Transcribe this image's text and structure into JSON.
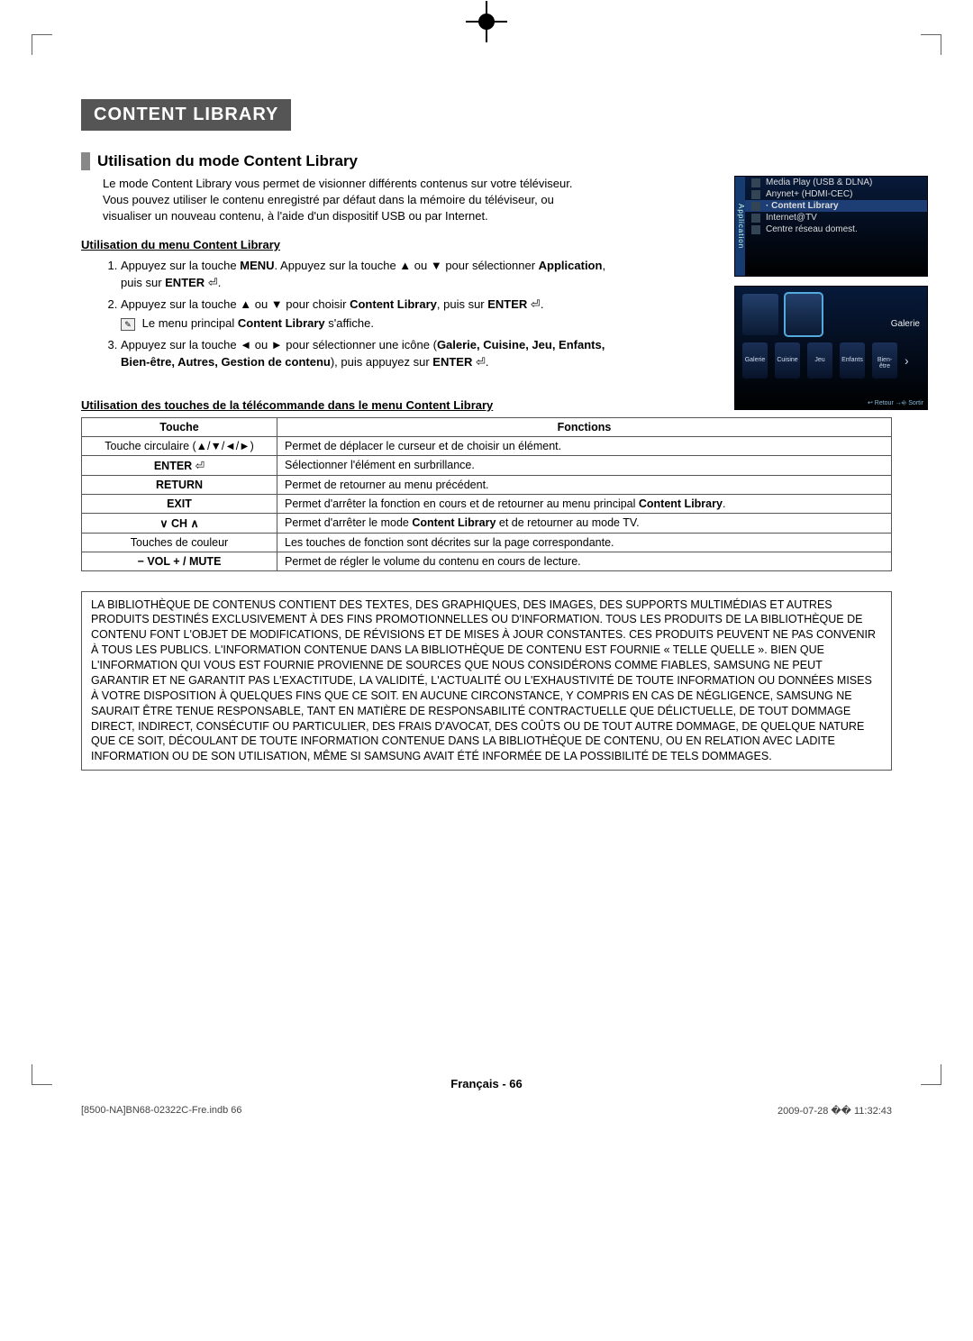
{
  "chapter": "CONTENT LIBRARY",
  "section_title": "Utilisation du mode Content Library",
  "intro": "Le mode Content Library vous permet de visionner différents contenus sur votre téléviseur. Vous pouvez utiliser le contenu enregistré par défaut dans la mémoire du téléviseur, ou visualiser un nouveau contenu, à l'aide d'un dispositif USB ou par Internet.",
  "sub1": "Utilisation du menu Content Library",
  "step1_a": "Appuyez sur la touche ",
  "step1_menu": "MENU",
  "step1_b": ". Appuyez sur la touche ▲ ou ▼ pour sélectionner ",
  "step1_app": "Application",
  "step1_c": ", puis sur ",
  "step1_enter": "ENTER",
  "step1_d": ".",
  "step2_a": "Appuyez sur la touche ▲ ou ▼ pour choisir ",
  "step2_cl": "Content Library",
  "step2_b": ", puis sur ",
  "step2_enter": "ENTER",
  "step2_c": ".",
  "step2_note_a": "Le menu principal ",
  "step2_note_cl": "Content Library",
  "step2_note_b": " s'affiche.",
  "step3_a": "Appuyez sur la touche ◄ ou ► pour sélectionner une icône (",
  "step3_list": "Galerie, Cuisine, Jeu, Enfants, Bien-être, Autres, Gestion de contenu",
  "step3_b": "), puis appuyez sur ",
  "step3_enter": "ENTER",
  "step3_c": ".",
  "sub2": "Utilisation des touches de la télécommande dans le menu Content Library",
  "table": {
    "th_key": "Touche",
    "th_fn": "Fonctions",
    "rows": [
      {
        "key": "Touche circulaire (▲/▼/◄/►)",
        "fn": "Permet de déplacer le curseur et de choisir un élément."
      },
      {
        "key_html": "<span class='b'>ENTER</span> ⏎",
        "fn": "Sélectionner l'élément en surbrillance."
      },
      {
        "key_html": "<span class='b'>RETURN</span>",
        "fn": "Permet de retourner au menu précédent."
      },
      {
        "key_html": "<span class='b'>EXIT</span>",
        "fn_html": "Permet d'arrêter la fonction en cours et de retourner au menu principal <span class='b'>Content Library</span>."
      },
      {
        "key_html": "<span class='b'>∨ CH ∧</span>",
        "fn_html": "Permet d'arrêter le mode <span class='b'>Content Library</span> et de retourner au mode TV."
      },
      {
        "key": "Touches de couleur",
        "fn": "Les touches de fonction sont décrites sur la page correspondante."
      },
      {
        "key_html": "<span class='b'>− VOL + / MUTE</span>",
        "fn": "Permet de régler le volume du contenu en cours de lecture."
      }
    ]
  },
  "disclaimer": "LA BIBLIOTHÈQUE DE CONTENUS CONTIENT DES TEXTES, DES GRAPHIQUES, DES IMAGES, DES SUPPORTS MULTIMÉDIAS ET AUTRES PRODUITS DESTINÉS EXCLUSIVEMENT À DES FINS PROMOTIONNELLES OU D'INFORMATION. TOUS LES PRODUITS DE LA BIBLIOTHÈQUE DE CONTENU FONT L'OBJET DE MODIFICATIONS, DE RÉVISIONS ET DE MISES À JOUR CONSTANTES. CES PRODUITS PEUVENT NE PAS CONVENIR À TOUS LES PUBLICS. L'INFORMATION CONTENUE DANS LA BIBLIOTHÈQUE DE CONTENU EST FOURNIE « TELLE QUELLE ». BIEN QUE L'INFORMATION QUI VOUS EST FOURNIE PROVIENNE DE SOURCES QUE NOUS CONSIDÉRONS COMME FIABLES, SAMSUNG NE PEUT GARANTIR ET NE GARANTIT PAS L'EXACTITUDE, LA VALIDITÉ, L'ACTUALITÉ OU L'EXHAUSTIVITÉ DE TOUTE INFORMATION OU DONNÉES MISES À VOTRE DISPOSITION À QUELQUES FINS QUE CE SOIT. EN AUCUNE CIRCONSTANCE, Y COMPRIS EN CAS DE NÉGLIGENCE, SAMSUNG NE SAURAIT ÊTRE TENUE RESPONSABLE, TANT EN MATIÈRE DE RESPONSABILITÉ CONTRACTUELLE QUE DÉLICTUELLE, DE TOUT DOMMAGE DIRECT, INDIRECT, CONSÉCUTIF OU PARTICULIER, DES FRAIS D'AVOCAT, DES COÛTS OU DE TOUT AUTRE DOMMAGE, DE QUELQUE NATURE QUE CE SOIT, DÉCOULANT DE TOUTE INFORMATION CONTENUE DANS LA BIBLIOTHÈQUE DE CONTENU, OU EN RELATION AVEC LADITE INFORMATION OU DE SON UTILISATION, MÊME SI SAMSUNG AVAIT ÉTÉ INFORMÉE DE LA POSSIBILITÉ DE TELS DOMMAGES.",
  "screenshot_menu": {
    "tab": "Application",
    "items": [
      "Media Play (USB & DLNA)",
      "Anynet+ (HDMI-CEC)",
      "Content Library",
      "Internet@TV",
      "Centre réseau domest."
    ],
    "selected_index": 2
  },
  "screenshot_tiles": {
    "side_label": "Galerie",
    "bottom": [
      "Galerie",
      "Cuisine",
      "Jeu",
      "Enfants",
      "Bien-être"
    ],
    "footer": "↩ Retour   →⎆ Sortir"
  },
  "page_footer": "Français - 66",
  "meta_left": "[8500-NA]BN68-02322C-Fre.indb   66",
  "meta_right": "2009-07-28   �� 11:32:43"
}
